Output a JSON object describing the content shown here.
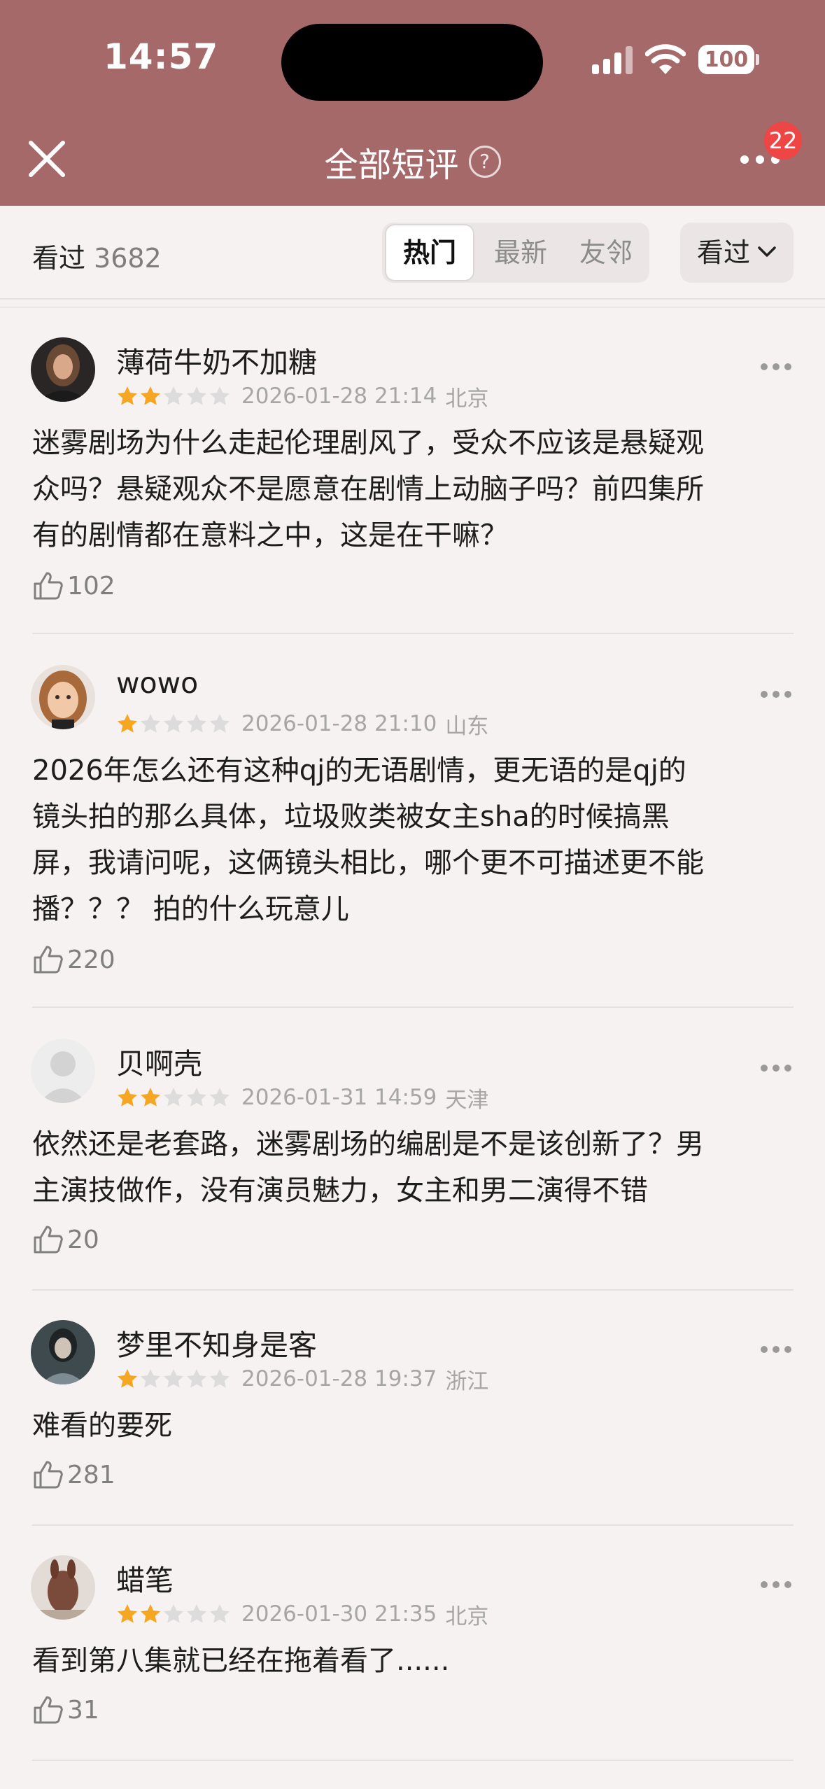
{
  "status_bar": {
    "time": "14:57",
    "battery": "100"
  },
  "nav": {
    "title": "全部短评",
    "help_symbol": "?",
    "badge_count": "22"
  },
  "filter": {
    "seen_label": "看过",
    "seen_count": "3682",
    "tabs": [
      {
        "label": "热门",
        "active": true
      },
      {
        "label": "最新",
        "active": false
      },
      {
        "label": "友邻",
        "active": false
      }
    ],
    "select_label": "看过"
  },
  "colors": {
    "header": "#a5696a",
    "star_filled": "#f5a623",
    "star_empty": "#dcdcdc",
    "badge": "#ee4545"
  },
  "reviews": [
    {
      "username": "薄荷牛奶不加糖",
      "rating": 2,
      "time": "2026-01-28 21:14",
      "location": "北京",
      "lines": [
        "迷雾剧场为什么走起伦理剧风了，受众不应该是悬疑观",
        "众吗？悬疑观众不是愿意在剧情上动脑子吗？前四集所",
        "有的剧情都在意料之中，这是在干嘛？"
      ],
      "likes": "102"
    },
    {
      "username": "wowo",
      "rating": 1,
      "time": "2026-01-28 21:10",
      "location": "山东",
      "lines": [
        "2026年怎么还有这种qj的无语剧情，更无语的是qj的",
        "镜头拍的那么具体，垃圾败类被女主sha的时候搞黑",
        "屏，我请问呢，这俩镜头相比，哪个更不可描述更不能",
        "播？？？ 拍的什么玩意儿"
      ],
      "likes": "220"
    },
    {
      "username": "贝啊壳",
      "rating": 2,
      "time": "2026-01-31 14:59",
      "location": "天津",
      "lines": [
        "依然还是老套路，迷雾剧场的编剧是不是该创新了？男",
        "主演技做作，没有演员魅力，女主和男二演得不错"
      ],
      "likes": "20"
    },
    {
      "username": "梦里不知身是客",
      "rating": 1,
      "time": "2026-01-28 19:37",
      "location": "浙江",
      "lines": [
        "难看的要死"
      ],
      "likes": "281"
    },
    {
      "username": "蜡笔",
      "rating": 2,
      "time": "2026-01-30 21:35",
      "location": "北京",
      "lines": [
        "看到第八集就已经在拖着看了......"
      ],
      "likes": "31"
    }
  ]
}
